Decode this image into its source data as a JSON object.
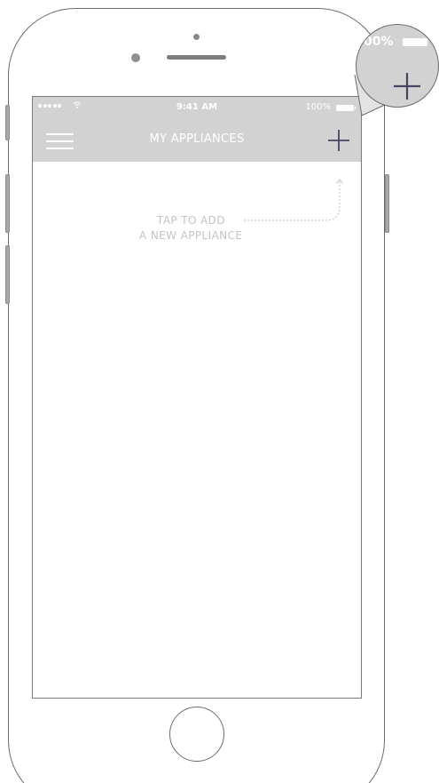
{
  "status_bar": {
    "time": "9:41 AM",
    "battery": "100%",
    "wifi_icon": "wifi-icon",
    "signal_icon": "signal-dots-icon"
  },
  "nav_bar": {
    "title": "MY APPLIANCES",
    "menu_icon": "hamburger-menu-icon",
    "add_icon": "plus-icon"
  },
  "hint": {
    "line1": "TAP TO ADD",
    "line2": "A NEW APPLIANCE"
  },
  "magnifier": {
    "battery_text": "00%",
    "plus_icon": "plus-icon"
  },
  "colors": {
    "nav_background": "#d2d2d2",
    "nav_text": "#ffffff",
    "accent_icon": "#4a4260",
    "hint_text": "#c4c4c4",
    "outline": "#6b6b6b"
  }
}
